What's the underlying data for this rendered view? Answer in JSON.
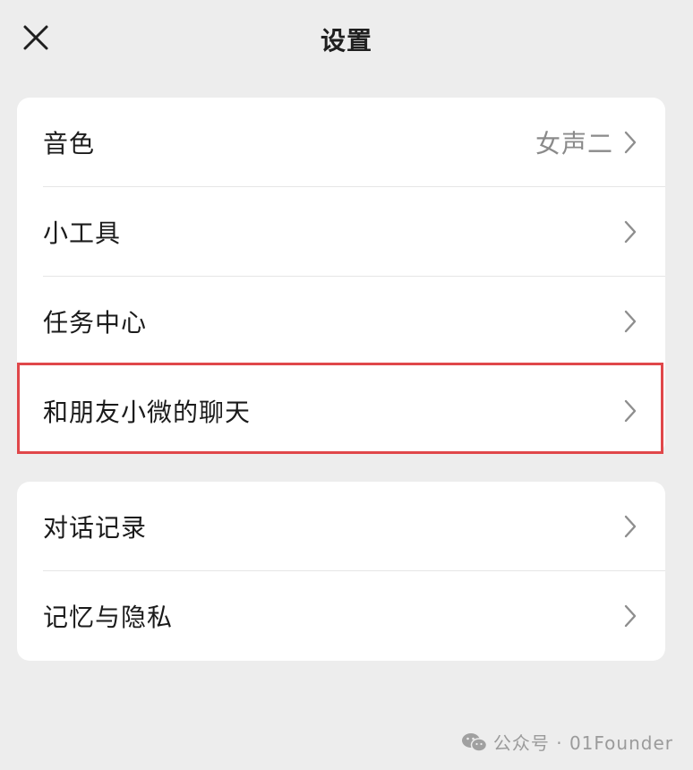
{
  "header": {
    "title": "设置",
    "close_icon": "close-icon"
  },
  "sections": [
    {
      "items": [
        {
          "label": "音色",
          "value": "女声二"
        },
        {
          "label": "小工具",
          "value": ""
        },
        {
          "label": "任务中心",
          "value": ""
        },
        {
          "label": "和朋友小微的聊天",
          "value": "",
          "highlighted": true
        }
      ]
    },
    {
      "items": [
        {
          "label": "对话记录",
          "value": ""
        },
        {
          "label": "记忆与隐私",
          "value": ""
        }
      ]
    }
  ],
  "watermark": {
    "text": "公众号 · 01Founder",
    "icon": "wechat-icon"
  },
  "colors": {
    "background": "#ededed",
    "card": "#ffffff",
    "highlight_border": "#e0474a",
    "text": "#1b1b1b",
    "secondary_text": "#8a8a8a"
  }
}
